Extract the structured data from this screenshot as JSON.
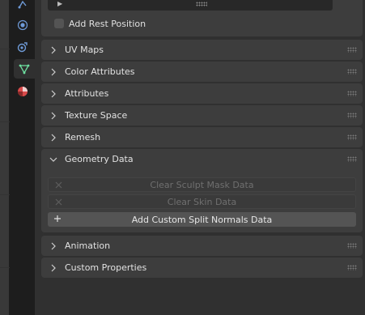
{
  "top_panel": {
    "add_rest_position_label": "Add Rest Position",
    "add_rest_position_checked": false
  },
  "panels": [
    {
      "label": "UV Maps",
      "expanded": false
    },
    {
      "label": "Color Attributes",
      "expanded": false
    },
    {
      "label": "Attributes",
      "expanded": false
    },
    {
      "label": "Texture Space",
      "expanded": false
    },
    {
      "label": "Remesh",
      "expanded": false
    },
    {
      "label": "Geometry Data",
      "expanded": true
    },
    {
      "label": "Animation",
      "expanded": false
    },
    {
      "label": "Custom Properties",
      "expanded": false
    }
  ],
  "geometry_data": {
    "buttons": [
      {
        "label": "Clear Sculpt Mask Data",
        "icon": "x-icon",
        "enabled": false
      },
      {
        "label": "Clear Skin Data",
        "icon": "x-icon",
        "enabled": false
      },
      {
        "label": "Add Custom Split Normals Data",
        "icon": "plus-icon",
        "enabled": true
      }
    ]
  },
  "tabs": [
    {
      "icon": "particles-icon",
      "active": false
    },
    {
      "icon": "physics-icon",
      "active": false
    },
    {
      "icon": "constraints-icon",
      "active": false
    },
    {
      "icon": "mesh-data-icon",
      "active": true
    },
    {
      "icon": "material-icon",
      "active": false
    }
  ],
  "colors": {
    "mesh_data_accent": "#6ee0a0",
    "physics_accent": "#6f9bd8",
    "material_accent": "#d94a4a"
  }
}
